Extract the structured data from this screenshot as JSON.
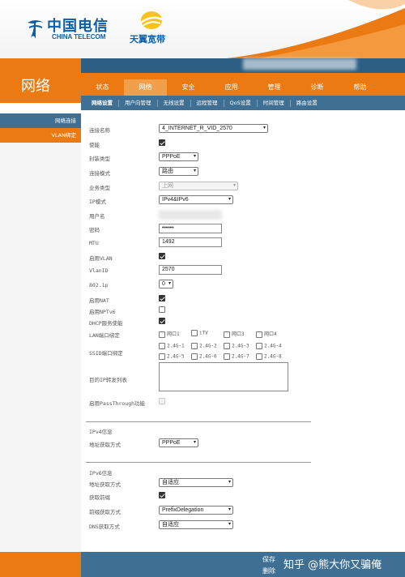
{
  "header": {
    "telecom_cn": "中国电信",
    "telecom_en": "CHINA TELECOM",
    "tianyi": "天翼宽带",
    "brand_color": "#0b5fa8",
    "accent_color": "#ec7a12",
    "bar_color": "#3f6f92"
  },
  "section_title": "网络",
  "main_tabs": [
    {
      "label": "状态"
    },
    {
      "label": "网络"
    },
    {
      "label": "安全"
    },
    {
      "label": "应用"
    },
    {
      "label": "管理"
    },
    {
      "label": "诊断"
    },
    {
      "label": "帮助"
    }
  ],
  "sub_tabs": [
    {
      "label": "网络设置"
    },
    {
      "label": "用户向管理"
    },
    {
      "label": "无线设置"
    },
    {
      "label": "远程管理"
    },
    {
      "label": "QoS设置"
    },
    {
      "label": "时间管理"
    },
    {
      "label": "路由设置"
    }
  ],
  "sidebar": {
    "items": [
      {
        "label": "网络连接"
      },
      {
        "label": "VLAN绑定"
      }
    ]
  },
  "form": {
    "conn_name_label": "连接名称",
    "conn_name_value": "4_INTERNET_R_VID_2570",
    "enable_label": "使能",
    "encap_label": "封装类型",
    "encap_value": "PPPoE",
    "conn_mode_label": "连接模式",
    "conn_mode_value": "路由",
    "service_label": "业务类型",
    "service_value": "上网",
    "ip_mode_label": "IP模式",
    "ip_mode_value": "IPv4&IPv6",
    "username_label": "用户名",
    "password_label": "密码",
    "password_value": "••••••",
    "mtu_label": "MTU",
    "mtu_value": "1492",
    "vlan_enable_label": "启用VLAN",
    "vlanid_label": "VlanID",
    "vlanid_value": "2570",
    "dot1p_label": "802.1p",
    "dot1p_value": "0",
    "nat_label": "启用NAT",
    "nptv6_label": "启用NPTv6",
    "dhcp_label": "DHCP服务使能",
    "lan_bind_label": "LAN端口绑定",
    "lan_ports": [
      "网口1",
      "iTV",
      "网口3",
      "网口4"
    ],
    "ssid_bind_label": "SSID端口绑定",
    "ssid_ports": [
      "2.4G-1",
      "2.4G-2",
      "2.4G-3",
      "2.4G-4",
      "2.4G-5",
      "2.4G-6",
      "2.4G-7",
      "2.4G-8"
    ],
    "dest_ip_label": "目的IP转发列表",
    "passthrough_label": "启用PassThrough功能",
    "ipv4_info_label": "IPv4信息",
    "ipv4_addr_mode_label": "地址获取方式",
    "ipv4_addr_mode_value": "PPPoE",
    "ipv6_info_label": "IPv6信息",
    "ipv6_addr_mode_label": "地址获取方式",
    "ipv6_addr_mode_value": "自适应",
    "prefix_get_label": "获取前缀",
    "prefix_mode_label": "前缀获取方式",
    "prefix_mode_value": "PrefixDelegation",
    "dns_mode_label": "DNS获取方式",
    "dns_mode_value": "自适应"
  },
  "footer": {
    "save_label": "保存",
    "delete_label": "删除",
    "watermark": "知乎 @熊大你又骗俺"
  }
}
